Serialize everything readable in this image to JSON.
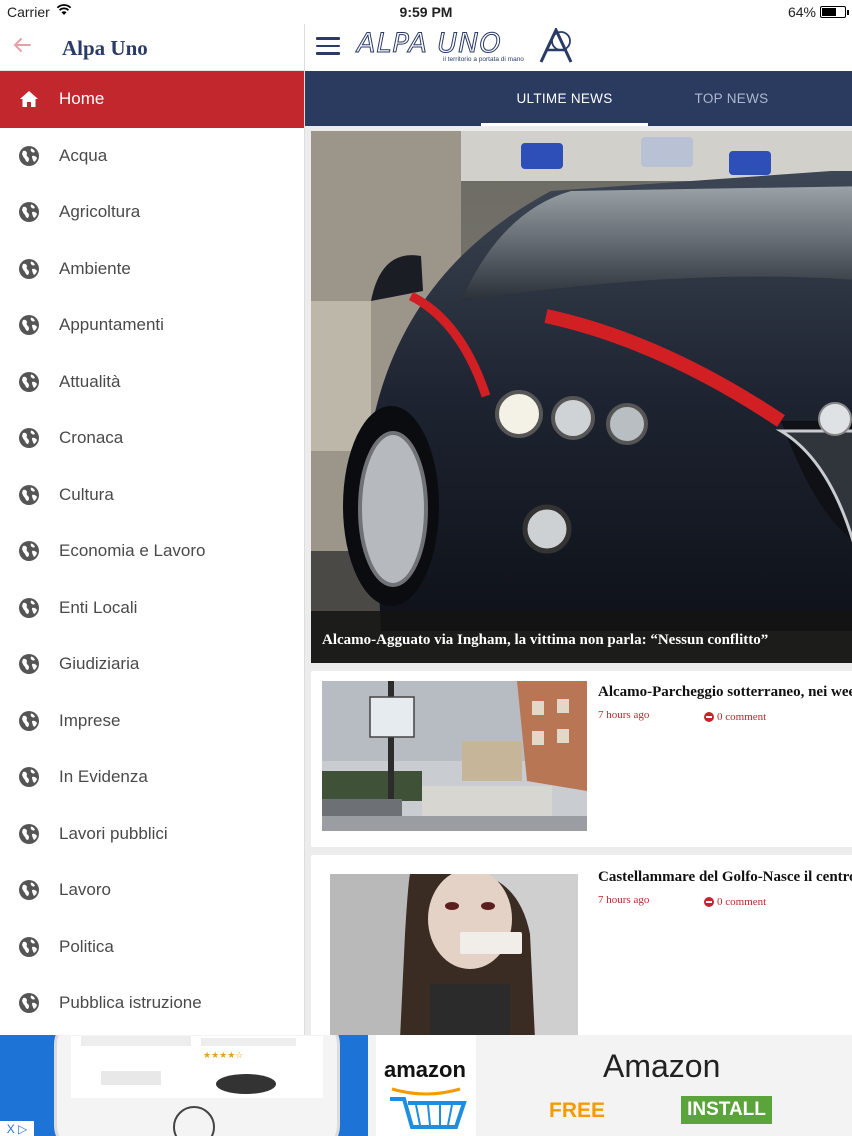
{
  "status_bar": {
    "carrier": "Carrier",
    "time": "9:59 PM",
    "battery": "64%",
    "battery_level": 0.64
  },
  "sidebar": {
    "title": "Alpa Uno",
    "back_icon": "arrow-left-icon",
    "items": [
      {
        "label": "Home",
        "icon": "home-icon",
        "active": true
      },
      {
        "label": "Acqua",
        "icon": "globe-icon"
      },
      {
        "label": "Agricoltura",
        "icon": "globe-icon"
      },
      {
        "label": "Ambiente",
        "icon": "globe-icon"
      },
      {
        "label": "Appuntamenti",
        "icon": "globe-icon"
      },
      {
        "label": "Attualità",
        "icon": "globe-icon"
      },
      {
        "label": "Cronaca",
        "icon": "globe-icon"
      },
      {
        "label": "Cultura",
        "icon": "globe-icon"
      },
      {
        "label": "Economia e Lavoro",
        "icon": "globe-icon"
      },
      {
        "label": "Enti Locali",
        "icon": "globe-icon"
      },
      {
        "label": "Giudiziaria",
        "icon": "globe-icon"
      },
      {
        "label": "Imprese",
        "icon": "globe-icon"
      },
      {
        "label": "In Evidenza",
        "icon": "globe-icon"
      },
      {
        "label": "Lavori pubblici",
        "icon": "globe-icon"
      },
      {
        "label": "Lavoro",
        "icon": "globe-icon"
      },
      {
        "label": "Politica",
        "icon": "globe-icon"
      },
      {
        "label": "Pubblica istruzione",
        "icon": "globe-icon"
      }
    ]
  },
  "header": {
    "menu_icon": "hamburger-icon",
    "logo_text": "ALPA UNO",
    "logo_tagline": "il territorio a portata di mano"
  },
  "tabs": [
    {
      "label": "ULTIME NEWS",
      "active": true
    },
    {
      "label": "TOP NEWS",
      "active": false
    }
  ],
  "featured": {
    "caption": "Alcamo-Agguato via Ingham, la vittima non parla: “Nessun conflitto”"
  },
  "articles": [
    {
      "title": "Alcamo-Parcheggio sotterraneo, nei wee",
      "time": "7 hours ago",
      "comments": "0 comment"
    },
    {
      "title": "Castellammare del Golfo-Nasce il centro",
      "time": "7 hours ago",
      "comments": "0 comment"
    }
  ],
  "ad": {
    "brand_word": "amazon",
    "title": "Amazon",
    "free_label": "FREE",
    "install_label": "INSTALL",
    "choices_label": "X ▷"
  },
  "colors": {
    "accent_red": "#c1272d",
    "navy": "#2a3b5f"
  }
}
